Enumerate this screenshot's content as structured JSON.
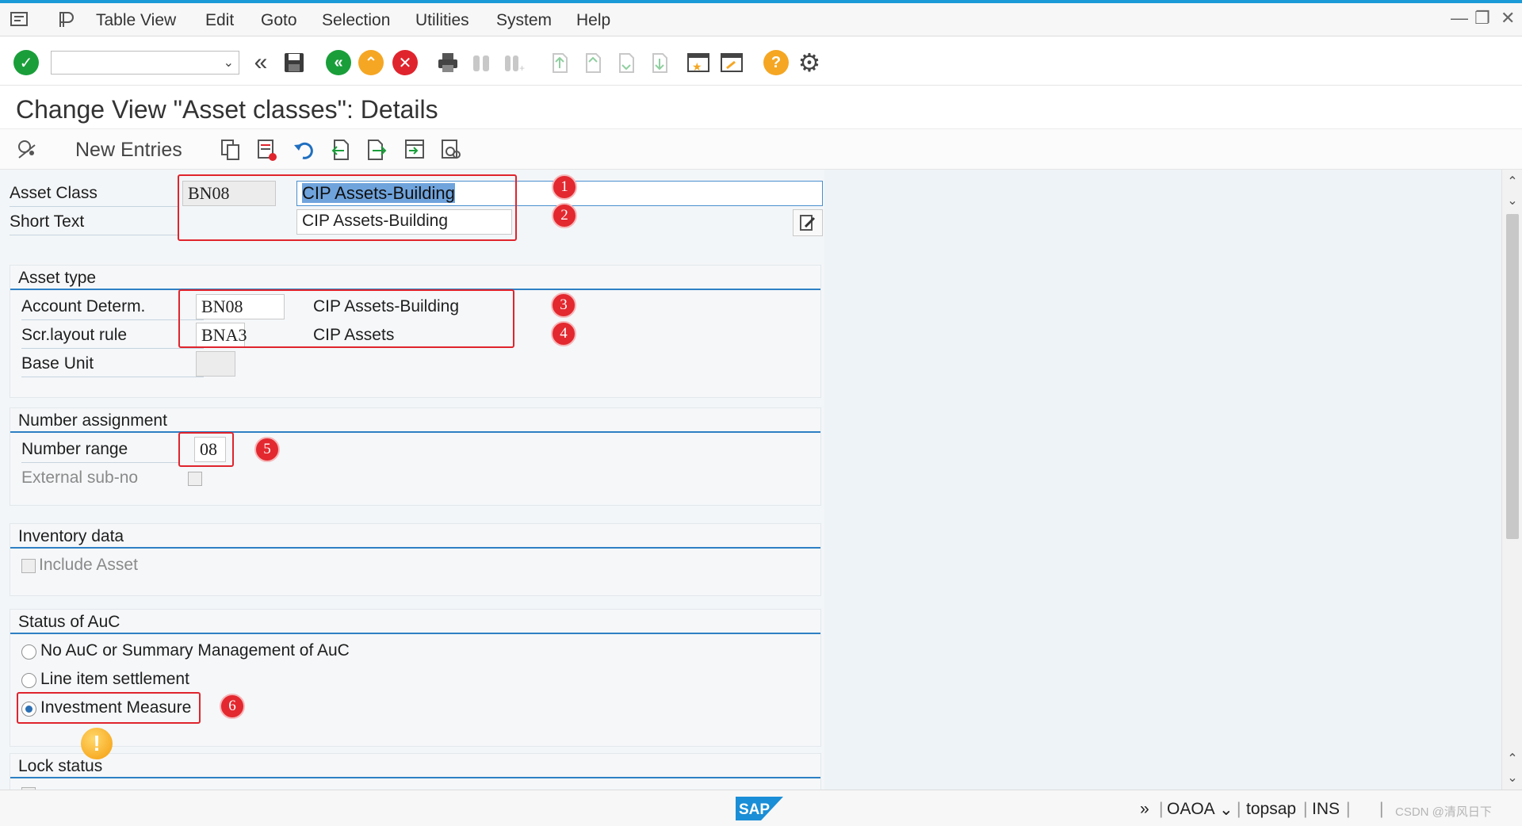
{
  "menu": {
    "items": [
      "Table View",
      "Edit",
      "Goto",
      "Selection",
      "Utilities",
      "System",
      "Help"
    ]
  },
  "title": "Change View \"Asset classes\": Details",
  "app_toolbar": {
    "new_entries": "New Entries"
  },
  "header_fields": {
    "asset_class_label": "Asset Class",
    "asset_class_value": "BN08",
    "asset_class_desc": "CIP Assets-Building",
    "short_text_label": "Short Text",
    "short_text_value": "CIP Assets-Building"
  },
  "groups": {
    "asset_type": {
      "title": "Asset type",
      "account_determ_label": "Account Determ.",
      "account_determ_value": "BN08",
      "account_determ_desc": "CIP Assets-Building",
      "scr_layout_label": "Scr.layout rule",
      "scr_layout_value": "BNA3",
      "scr_layout_desc": "CIP Assets",
      "base_unit_label": "Base Unit"
    },
    "number_assignment": {
      "title": "Number assignment",
      "number_range_label": "Number range",
      "number_range_value": "08",
      "external_subno_label": "External sub-no"
    },
    "inventory_data": {
      "title": "Inventory data",
      "include_asset_label": "Include Asset"
    },
    "status_auc": {
      "title": "Status of AuC",
      "options": [
        "No AuC or Summary Management of AuC",
        "Line item settlement",
        "Investment Measure"
      ],
      "selected": "Investment Measure"
    },
    "lock_status": {
      "title": "Lock status"
    }
  },
  "badges": [
    "1",
    "2",
    "3",
    "4",
    "5",
    "6"
  ],
  "statusbar": {
    "arrows": "»",
    "system": "OAOA",
    "server": "topsap",
    "mode": "INS",
    "logo": "SAP",
    "watermark": "CSDN @清风日下"
  },
  "colors": {
    "accent_blue": "#2e80c4",
    "highlight_red": "#e0242d",
    "ok_green": "#1a9e3a",
    "warning_orange": "#f5a623",
    "cancel_red": "#e0242d"
  }
}
